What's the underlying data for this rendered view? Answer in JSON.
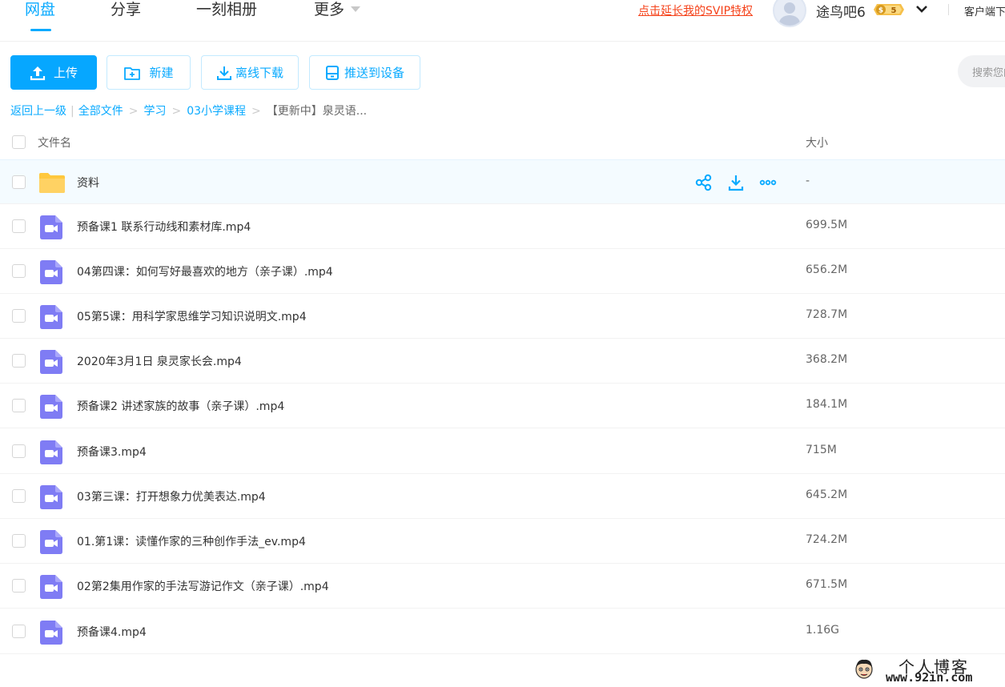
{
  "nav": {
    "tabs": [
      {
        "label": "网盘",
        "active": true
      },
      {
        "label": "分享",
        "active": false
      },
      {
        "label": "一刻相册",
        "active": false
      },
      {
        "label": "更多",
        "active": false
      }
    ],
    "svip_link": "点击延长我的SVIP特权",
    "username": "途鸟吧6",
    "vip_level": "5",
    "client_link": "客户端下载"
  },
  "toolbar": {
    "upload_label": "上传",
    "new_label": "新建",
    "offline_download_label": "离线下载",
    "push_to_device_label": "推送到设备",
    "search_placeholder": "搜索您的文件"
  },
  "breadcrumb": {
    "back": "返回上一级",
    "items": [
      "全部文件",
      "学习",
      "03小学课程"
    ],
    "current": "【更新中】泉灵语..."
  },
  "table": {
    "columns": {
      "name": "文件名",
      "size": "大小"
    },
    "rows": [
      {
        "name": "资料",
        "size": "-",
        "type": "folder"
      },
      {
        "name": "预备课1 联系行动线和素材库.mp4",
        "size": "699.5M",
        "type": "video"
      },
      {
        "name": "04第四课：如何写好最喜欢的地方（亲子课）.mp4",
        "size": "656.2M",
        "type": "video"
      },
      {
        "name": "05第5课：用科学家思维学习知识说明文.mp4",
        "size": "728.7M",
        "type": "video"
      },
      {
        "name": "2020年3月1日 泉灵家长会.mp4",
        "size": "368.2M",
        "type": "video"
      },
      {
        "name": "预备课2 讲述家族的故事（亲子课）.mp4",
        "size": "184.1M",
        "type": "video"
      },
      {
        "name": "预备课3.mp4",
        "size": "715M",
        "type": "video"
      },
      {
        "name": "03第三课：打开想象力优美表达.mp4",
        "size": "645.2M",
        "type": "video"
      },
      {
        "name": "01.第1课：读懂作家的三种创作手法_ev.mp4",
        "size": "724.2M",
        "type": "video"
      },
      {
        "name": "02第2集用作家的手法写游记作文（亲子课）.mp4",
        "size": "671.5M",
        "type": "video"
      },
      {
        "name": "预备课4.mp4",
        "size": "1.16G",
        "type": "video"
      }
    ]
  },
  "watermark": {
    "title": "个人博客",
    "url": "www.92in.com"
  },
  "colors": {
    "accent": "#09aaff",
    "svip": "#f5421a",
    "video_icon": "#7f7cf4",
    "folder_icon": "#ffd263"
  }
}
